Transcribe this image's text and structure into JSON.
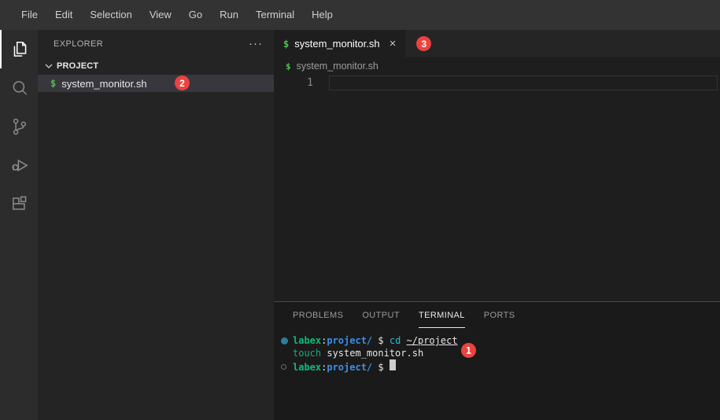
{
  "menu_bar": {
    "items": [
      "File",
      "Edit",
      "Selection",
      "View",
      "Go",
      "Run",
      "Terminal",
      "Help"
    ]
  },
  "activity_bar": {
    "items": [
      {
        "name": "explorer",
        "active": true
      },
      {
        "name": "search",
        "active": false
      },
      {
        "name": "source-control",
        "active": false
      },
      {
        "name": "run-and-debug",
        "active": false
      },
      {
        "name": "extensions",
        "active": false
      }
    ]
  },
  "sidebar": {
    "title": "EXPLORER",
    "more_icon": "···",
    "section_label": "PROJECT",
    "file": {
      "icon": "$",
      "name": "system_monitor.sh",
      "badge": "2"
    }
  },
  "editor": {
    "tab": {
      "icon": "$",
      "label": "system_monitor.sh",
      "close_icon": "×",
      "badge": "3"
    },
    "breadcrumb": {
      "icon": "$",
      "label": "system_monitor.sh"
    },
    "line_number": "1"
  },
  "panel": {
    "tabs": {
      "problems": "PROBLEMS",
      "output": "OUTPUT",
      "terminal": "TERMINAL",
      "ports": "PORTS"
    },
    "terminal": {
      "prompt_user": "labex",
      "prompt_colon": ":",
      "prompt_dir": "project/",
      "prompt_dollar": " $ ",
      "command1": "cd",
      "space": " ",
      "command1_arg": "~/project",
      "command2": "touch",
      "command2_arg": "system_monitor.sh",
      "badge": "1"
    }
  },
  "colors": {
    "badge_red": "#ea4340",
    "shell_icon_green": "#4ec253",
    "terminal_green": "#0dbc79",
    "terminal_blue": "#3b8eea",
    "terminal_cyan": "#29b8db",
    "terminal_teal": "#1fa97c",
    "terminal_foreground": "#e8e8e8",
    "selected_row": "#37373d"
  }
}
